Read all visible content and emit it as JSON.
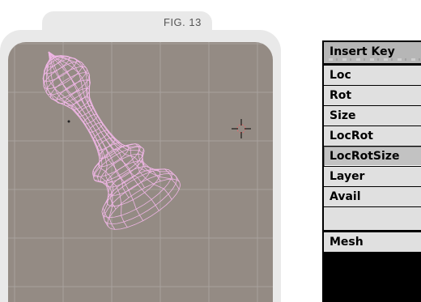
{
  "figure": {
    "label": "FIG. 13"
  },
  "viewport": {
    "background_color": "#948b84",
    "grid_color": "#a8a29d",
    "wire_color": "#f0b6e6",
    "cursor_icon": "3d-cursor-icon",
    "object_name": "pawn-wireframe-mesh"
  },
  "menu": {
    "title": "Insert Key",
    "items": [
      {
        "label": "Loc"
      },
      {
        "label": "Rot"
      },
      {
        "label": "Size"
      },
      {
        "label": "LocRot"
      },
      {
        "label": "LocRotSize",
        "selected": true
      },
      {
        "label": "Layer"
      },
      {
        "label": "Avail"
      },
      {
        "label": ""
      },
      {
        "label": "Mesh"
      }
    ]
  }
}
